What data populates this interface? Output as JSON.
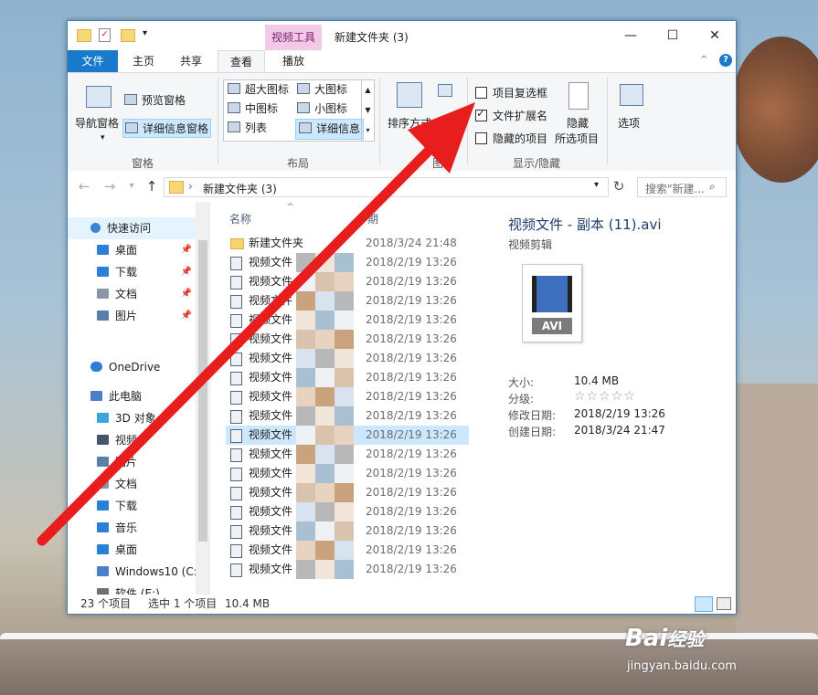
{
  "window": {
    "title": "新建文件夹 (3)",
    "context_tab": "视频工具",
    "controls": {
      "minimize": "—",
      "maximize": "☐",
      "close": "✕"
    }
  },
  "tabs": [
    {
      "label": "文件"
    },
    {
      "label": "主页"
    },
    {
      "label": "共享"
    },
    {
      "label": "查看"
    },
    {
      "label": "播放"
    }
  ],
  "ribbon": {
    "pane_group": {
      "nav_pane": "导航窗格",
      "preview_pane": "预览窗格",
      "details_pane": "详细信息窗格",
      "label": "窗格"
    },
    "layout_group": {
      "items": [
        "超大图标",
        "大图标",
        "中图标",
        "小图标",
        "列表",
        "详细信息"
      ],
      "label": "布局"
    },
    "view_group": {
      "sort": "排序方式",
      "label_partial": "图"
    },
    "show_hide_group": {
      "item_checkboxes": "项目复选框",
      "file_extensions": "文件扩展名",
      "hidden_items": "隐藏的项目",
      "hide_selected_line1": "隐藏",
      "hide_selected_line2": "所选项目",
      "label": "显示/隐藏",
      "item_checkboxes_checked": false,
      "file_extensions_checked": true,
      "hidden_items_checked": false
    },
    "options": "选项"
  },
  "address": {
    "path": "新建文件夹 (3)",
    "search_placeholder": "搜索\"新建..."
  },
  "nav": {
    "quick_access": "快速访问",
    "items": [
      {
        "label": "桌面",
        "pinned": true,
        "color": "#2b7fd4"
      },
      {
        "label": "下载",
        "pinned": true,
        "color": "#2b7fd4"
      },
      {
        "label": "文档",
        "pinned": true,
        "color": "#8a96a8"
      },
      {
        "label": "图片",
        "pinned": true,
        "color": "#5a7fa8"
      }
    ],
    "onedrive": "OneDrive",
    "this_pc": "此电脑",
    "pc_items": [
      {
        "label": "3D 对象",
        "color": "#3aa7d8"
      },
      {
        "label": "视频",
        "color": "#44556b"
      },
      {
        "label": "图片",
        "color": "#5a7fa8"
      },
      {
        "label": "文档",
        "color": "#8a96a8"
      },
      {
        "label": "下载",
        "color": "#2b7fd4"
      },
      {
        "label": "音乐",
        "color": "#2b7fd4"
      },
      {
        "label": "桌面",
        "color": "#2b7fd4"
      },
      {
        "label": "Windows10 (C:",
        "color": "#4a80c8"
      },
      {
        "label": "软件 (E:)",
        "color": "#707070"
      }
    ]
  },
  "list": {
    "col_name": "名称",
    "col_date_partial": "期",
    "rows": [
      {
        "name": "新建文件夹",
        "date": "2018/3/24 21:48",
        "type": "folder"
      },
      {
        "name": "视频文件",
        "date": "2018/2/19 13:26",
        "type": "file"
      },
      {
        "name": "视频文件",
        "date": "2018/2/19 13:26",
        "type": "file"
      },
      {
        "name": "视频文件",
        "date": "2018/2/19 13:26",
        "type": "file"
      },
      {
        "name": "视频文件",
        "date": "2018/2/19 13:26",
        "type": "file"
      },
      {
        "name": "视频文件",
        "date": "2018/2/19 13:26",
        "type": "file"
      },
      {
        "name": "视频文件",
        "date": "2018/2/19 13:26",
        "type": "file"
      },
      {
        "name": "视频文件",
        "date": "2018/2/19 13:26",
        "type": "file"
      },
      {
        "name": "视频文件",
        "date": "2018/2/19 13:26",
        "type": "file"
      },
      {
        "name": "视频文件",
        "date": "2018/2/19 13:26",
        "type": "file"
      },
      {
        "name": "视频文件",
        "date": "2018/2/19 13:26",
        "type": "file",
        "selected": true
      },
      {
        "name": "视频文件",
        "date": "2018/2/19 13:26",
        "type": "file"
      },
      {
        "name": "视频文件",
        "date": "2018/2/19 13:26",
        "type": "file"
      },
      {
        "name": "视频文件",
        "date": "2018/2/19 13:26",
        "type": "file"
      },
      {
        "name": "视频文件",
        "date": "2018/2/19 13:26",
        "type": "file"
      },
      {
        "name": "视频文件",
        "date": "2018/2/19 13:26",
        "type": "file"
      },
      {
        "name": "视频文件",
        "date": "2018/2/19 13:26",
        "type": "file"
      },
      {
        "name": "视频文件",
        "date": "2018/2/19 13:26",
        "type": "file"
      }
    ]
  },
  "details": {
    "filename": "视频文件 - 副本 (11).avi",
    "type": "视频剪辑",
    "thumb_label": "AVI",
    "size_label": "大小:",
    "size_value": "10.4 MB",
    "rating_label": "分级:",
    "rating_value": "☆☆☆☆☆",
    "modified_label": "修改日期:",
    "modified_value": "2018/2/19 13:26",
    "created_label": "创建日期:",
    "created_value": "2018/3/24 21:47"
  },
  "status": {
    "count": "23 个项目",
    "selected": "选中 1 个项目",
    "size": "10.4 MB"
  },
  "watermark": {
    "brand": "Bai",
    "brand2": "经验",
    "url": "jingyan.baidu.com"
  },
  "colors": {
    "accent": "#1979ca",
    "arrow": "#e81e1e",
    "selection": "#cce8ff"
  }
}
